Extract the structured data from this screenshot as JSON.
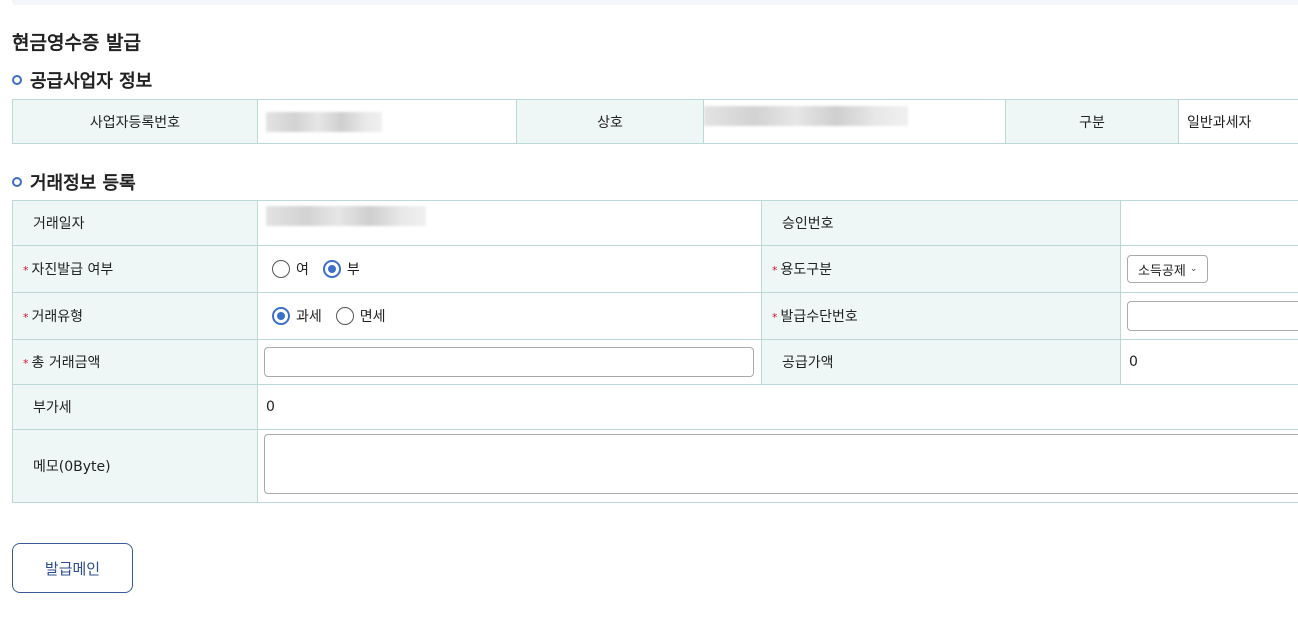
{
  "page": {
    "title": "현금영수증 발급"
  },
  "supplier_section": {
    "title": "공급사업자 정보",
    "business_number_label": "사업자등록번호",
    "company_name_label": "상호",
    "category_label": "구분",
    "category_value": "일반과세자"
  },
  "trade_section": {
    "title": "거래정보 등록",
    "trade_date_label": "거래일자",
    "approval_number_label": "승인번호",
    "approval_number_value": "",
    "self_issue_label": "자진발급 여부",
    "self_issue_options": [
      "여",
      "부"
    ],
    "self_issue_selected": "부",
    "purpose_label": "용도구분",
    "purpose_selected": "소득공제",
    "trade_type_label": "거래유형",
    "trade_type_options": [
      "과세",
      "면세"
    ],
    "trade_type_selected": "과세",
    "issue_means_label": "발급수단번호",
    "issue_means_value": "",
    "total_amount_label": "총 거래금액",
    "total_amount_value": "",
    "supply_amount_label": "공급가액",
    "supply_amount_value": "0",
    "vat_label": "부가세",
    "vat_value": "0",
    "memo_label": "메모(0Byte)",
    "memo_value": "",
    "required_mark": "*"
  },
  "actions": {
    "issue_button": "발급메인"
  },
  "colors": {
    "accent": "#3b6fc9",
    "header_cell_bg": "#eef7f6",
    "border": "#bcd8d6",
    "required": "#d0103a",
    "button_text": "#2b4d8f"
  }
}
